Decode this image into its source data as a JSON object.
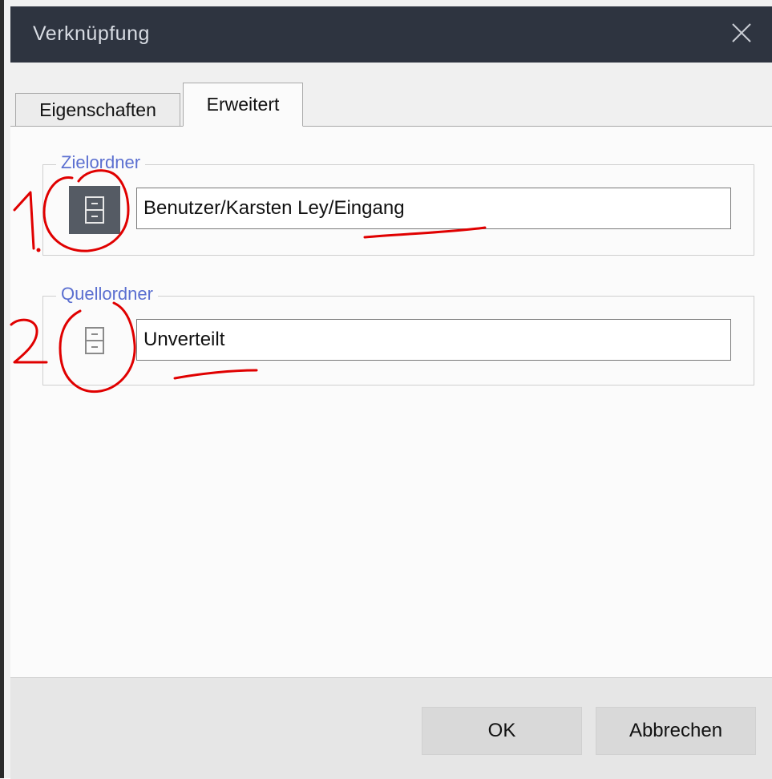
{
  "window": {
    "title": "Verknüpfung"
  },
  "tabs": [
    {
      "label": "Eigenschaften",
      "active": false
    },
    {
      "label": "Erweitert",
      "active": true
    }
  ],
  "groups": {
    "target": {
      "label": "Zielordner",
      "icon": "cabinet-icon",
      "value": "Benutzer/Karsten Ley/Eingang"
    },
    "source": {
      "label": "Quellordner",
      "icon": "cabinet-icon",
      "value": "Unverteilt"
    }
  },
  "buttons": {
    "ok": "OK",
    "cancel": "Abbrechen"
  },
  "annotations": {
    "mark1": "1.",
    "mark2": "2"
  },
  "colors": {
    "titlebar": "#2e3440",
    "group_label": "#5b6fd0",
    "annotation": "#e00000"
  }
}
